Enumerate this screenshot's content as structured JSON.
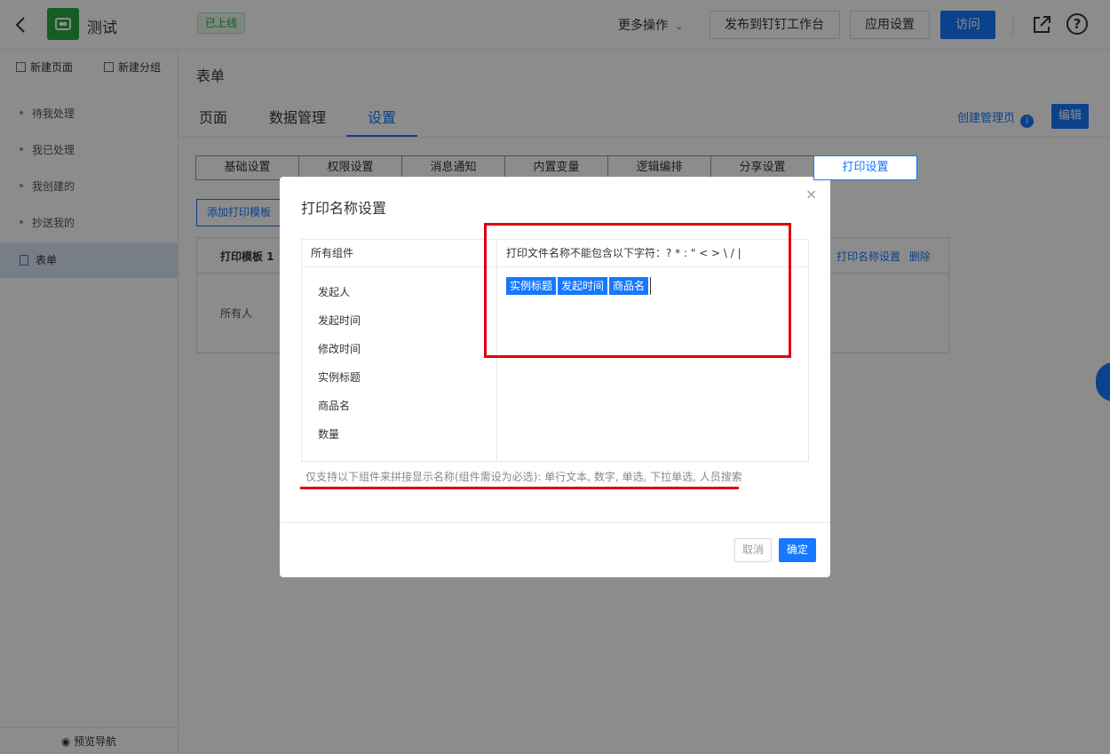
{
  "header": {
    "app_name": "测试",
    "status_badge": "已上线",
    "more_ops": "更多操作",
    "publish_label": "发布到钉钉工作台",
    "app_settings_label": "应用设置",
    "visit_label": "访问",
    "help_glyph": "?"
  },
  "sidebar": {
    "new_page": "新建页面",
    "new_group": "新建分组",
    "items": [
      {
        "label": "待我处理"
      },
      {
        "label": "我已处理"
      },
      {
        "label": "我创建的"
      },
      {
        "label": "抄送我的"
      },
      {
        "label": "表单"
      }
    ],
    "preview_nav": "预览导航"
  },
  "main": {
    "title": "表单",
    "tabs": [
      {
        "label": "页面"
      },
      {
        "label": "数据管理"
      },
      {
        "label": "设置"
      }
    ],
    "create_mgmt": "创建管理页",
    "edit_label": "编辑",
    "subtabs": [
      {
        "label": "基础设置"
      },
      {
        "label": "权限设置"
      },
      {
        "label": "消息通知"
      },
      {
        "label": "内置变量"
      },
      {
        "label": "逻辑编排"
      },
      {
        "label": "分享设置"
      },
      {
        "label": "打印设置"
      }
    ],
    "add_template": "添加打印模板",
    "template_name": "打印模板 1",
    "template_link_name": "打印名称设置",
    "template_link_delete": "删除",
    "owner_label": "所有人"
  },
  "modal": {
    "title": "打印名称设置",
    "close_glyph": "×",
    "left_header": "所有组件",
    "components": [
      {
        "label": "发起人"
      },
      {
        "label": "发起时间"
      },
      {
        "label": "修改时间"
      },
      {
        "label": "实例标题"
      },
      {
        "label": "商品名"
      },
      {
        "label": "数量"
      }
    ],
    "right_header": "打印文件名称不能包含以下字符：? * : \" < > \\ / |",
    "tags": [
      {
        "label": "实例标题"
      },
      {
        "label": "发起时间"
      },
      {
        "label": "商品名"
      }
    ],
    "hint": "仅支持以下组件来拼接显示名称(组件需设为必选): 单行文本, 数字, 单选, 下拉单选, 人员搜索",
    "cancel_label": "取消",
    "ok_label": "确定"
  },
  "colors": {
    "accent": "#1677ff",
    "brand_green": "#27a844",
    "annotation_red": "#e0000f"
  }
}
